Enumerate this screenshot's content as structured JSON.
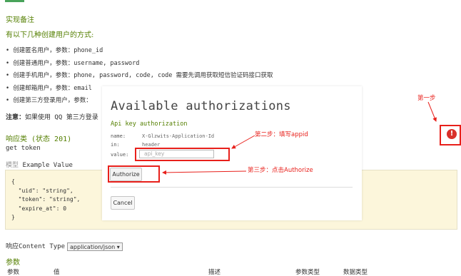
{
  "doc": {
    "section_title": "实现备注",
    "section_sub": "有以下几种创建用户的方式:",
    "bullets": [
      "创建匿名用户，参数：phone_id",
      "创建普通用户，参数：username, password",
      "创建手机用户，参数：phone, password, code, code 需要先调用获取短信验证码接口获取",
      "创建邮箱用户，参数：email",
      "创建第三方登录用户，参数："
    ],
    "note_label": "注意：",
    "note_text": "如果使用 QQ 第三方登录",
    "response_class": "响应类 (状态 201)",
    "response_desc": "get token",
    "model_label": "模型",
    "model_example": "Example Value",
    "code_example": "{\n  \"uid\": \"string\",\n  \"token\": \"string\",\n  \"expire_at\": 0\n}",
    "content_type_label": "响应Content Type",
    "content_type_value": "application/json ▾",
    "params_title": "参数",
    "params_headers": [
      "参数",
      "值",
      "描述",
      "参数类型",
      "数据类型"
    ]
  },
  "modal": {
    "title": "Available authorizations",
    "api_key_title": "Api key authorization",
    "name_label": "name:",
    "name_value": "X-Glzwits-Application-Id",
    "in_label": "in:",
    "in_value": "header",
    "value_label": "value:",
    "value_placeholder": "api_key",
    "authorize_label": "Authorize",
    "cancel_label": "Cancel"
  },
  "annotations": {
    "step1": "第一步",
    "step2": "第二步：填写appid",
    "step3": "第三步：点击Authorize",
    "color": "#e8201b"
  },
  "icons": {
    "error_icon": "exclamation-circle-icon",
    "error_glyph": "!"
  },
  "colors": {
    "heading_green": "#547f00",
    "code_bg": "#fcf6db",
    "tab_green": "#49a35a"
  }
}
